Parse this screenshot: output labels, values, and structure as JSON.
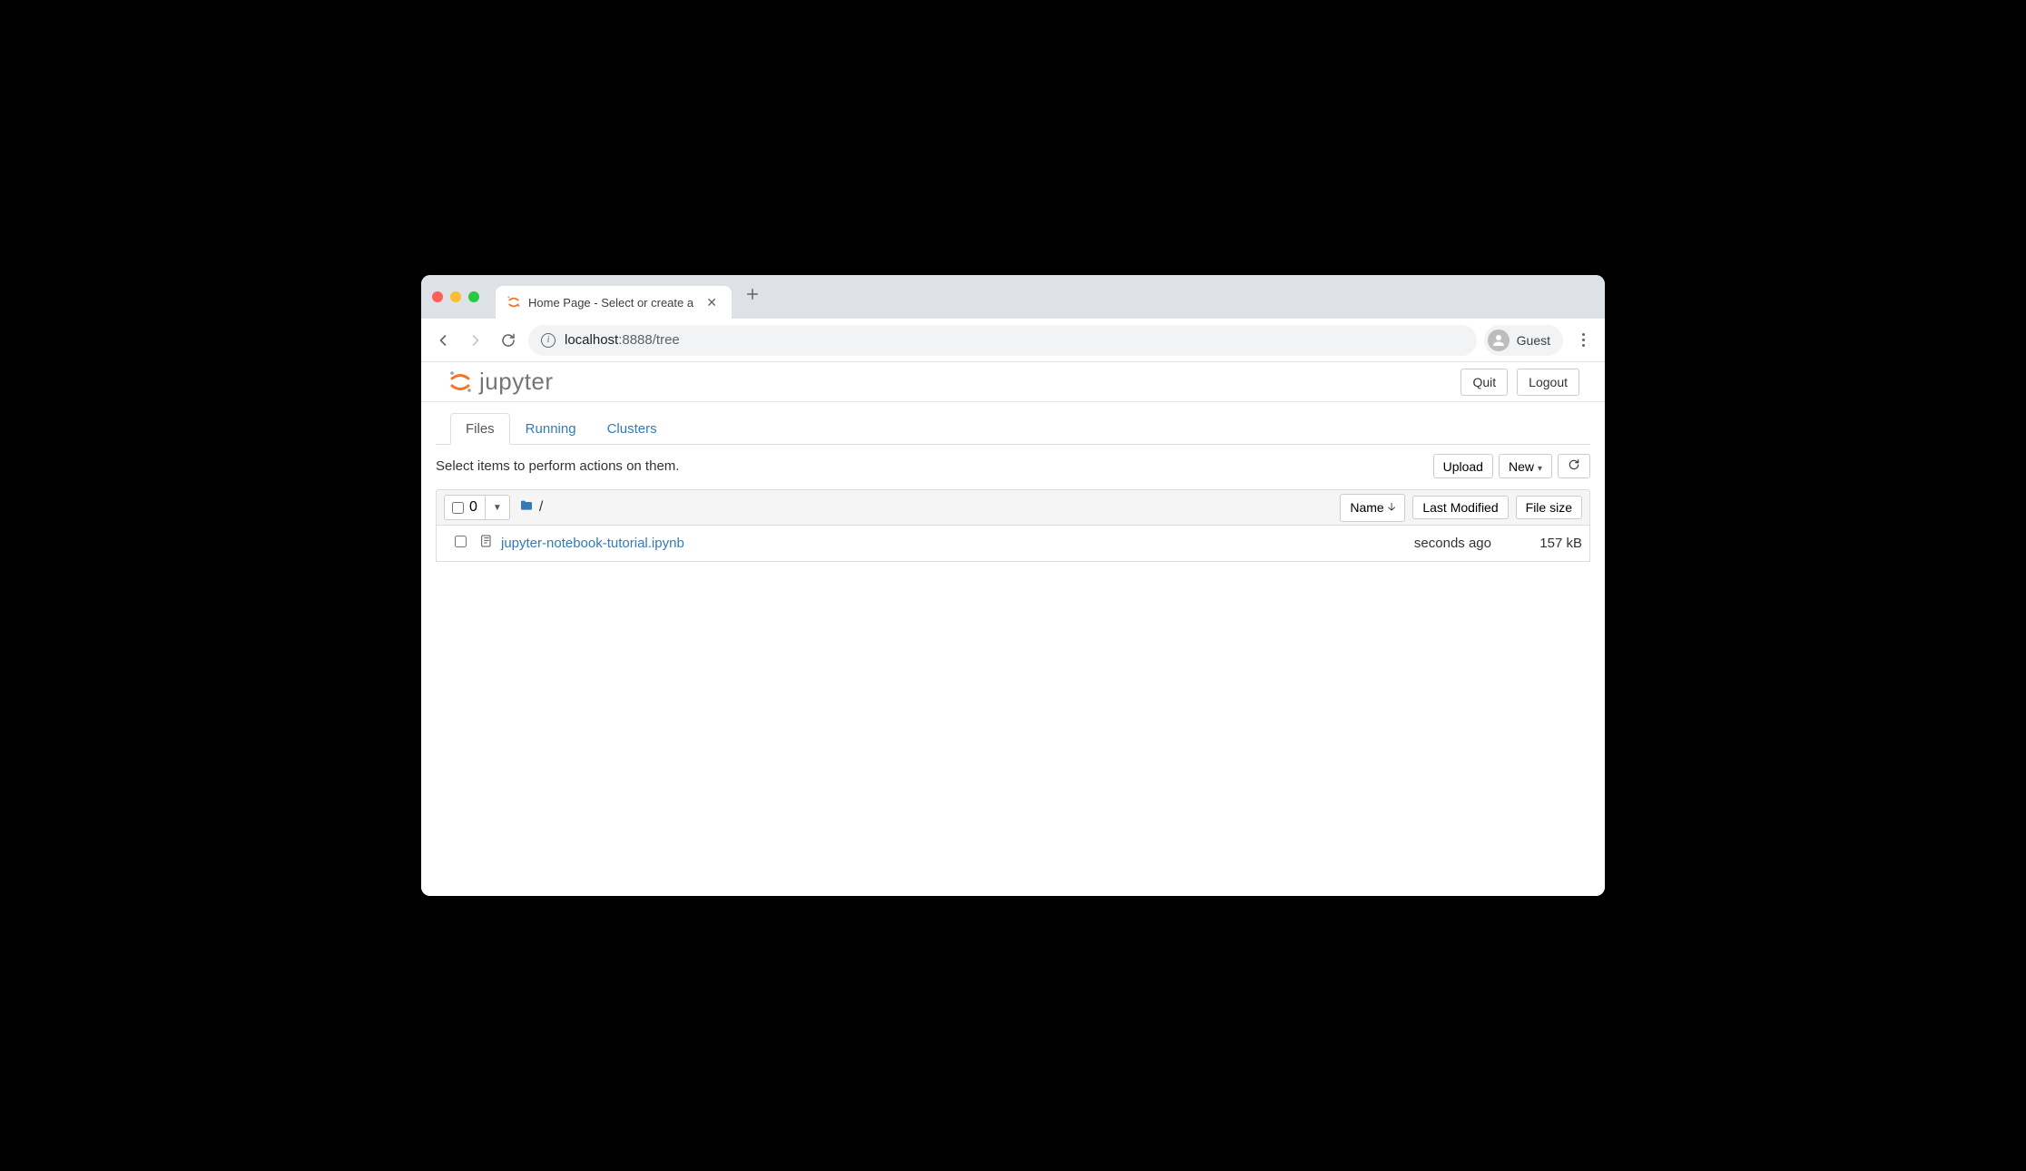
{
  "browser": {
    "tab_title": "Home Page - Select or create a n",
    "url_host": "localhost",
    "url_port_path": ":8888/tree",
    "profile_label": "Guest"
  },
  "jupyter": {
    "logo_text": "jupyter",
    "header_buttons": {
      "quit": "Quit",
      "logout": "Logout"
    },
    "tabs": {
      "files": "Files",
      "running": "Running",
      "clusters": "Clusters"
    },
    "hint": "Select items to perform actions on them.",
    "actions": {
      "upload": "Upload",
      "new": "New"
    },
    "list_header": {
      "selected_count": "0",
      "breadcrumb_sep": "/",
      "col_name": "Name",
      "col_modified": "Last Modified",
      "col_size": "File size"
    },
    "files": [
      {
        "name": "jupyter-notebook-tutorial.ipynb",
        "modified": "seconds ago",
        "size": "157 kB"
      }
    ]
  }
}
